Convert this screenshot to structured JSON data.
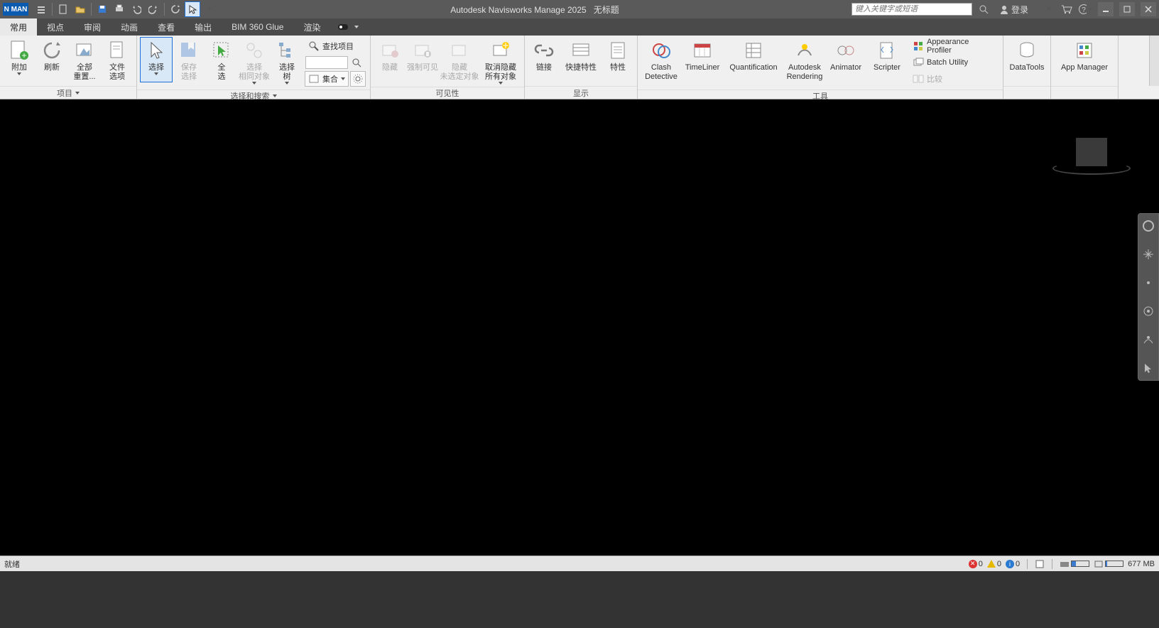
{
  "titlebar": {
    "logo": "N MAN",
    "app_title": "Autodesk Navisworks Manage 2025",
    "doc_title": "无标题",
    "search_placeholder": "键入关键字或短语",
    "login_label": "登录"
  },
  "tabs": {
    "items": [
      "常用",
      "视点",
      "审阅",
      "动画",
      "查看",
      "输出",
      "BIM 360 Glue",
      "渲染"
    ],
    "active_index": 0
  },
  "ribbon": {
    "panel_project": {
      "title": "项目",
      "append": "附加",
      "refresh": "刷新",
      "reset_all": "全部\n重置...",
      "file_options": "文件\n选项"
    },
    "panel_select": {
      "title": "选择和搜索",
      "select": "选择",
      "save_sel": "保存\n选择",
      "select_all": "全\n选",
      "select_same": "选择\n相同对象",
      "sel_tree": "选择\n树",
      "find_items": "查找项目",
      "sets": "集合"
    },
    "panel_vis": {
      "title": "可见性",
      "hide": "隐藏",
      "require": "强制可见",
      "hide_unsel": "隐藏\n未选定对象",
      "unhide_all": "取消隐藏\n所有对象"
    },
    "panel_disp": {
      "title": "显示",
      "links": "链接",
      "quick_props": "快捷特性",
      "props": "特性"
    },
    "panel_tools": {
      "title": "工具",
      "clash": "Clash\nDetective",
      "timeliner": "TimeLiner",
      "quant": "Quantification",
      "rendering": "Autodesk\nRendering",
      "animator": "Animator",
      "scripter": "Scripter",
      "appearance": "Appearance Profiler",
      "batch": "Batch Utility",
      "compare": "比较"
    },
    "panel_data": {
      "datatools": "DataTools"
    },
    "panel_app": {
      "appmgr": "App Manager"
    }
  },
  "status": {
    "ready": "就绪",
    "err": "0",
    "warn": "0",
    "info": "0",
    "mem": "677 MB"
  }
}
